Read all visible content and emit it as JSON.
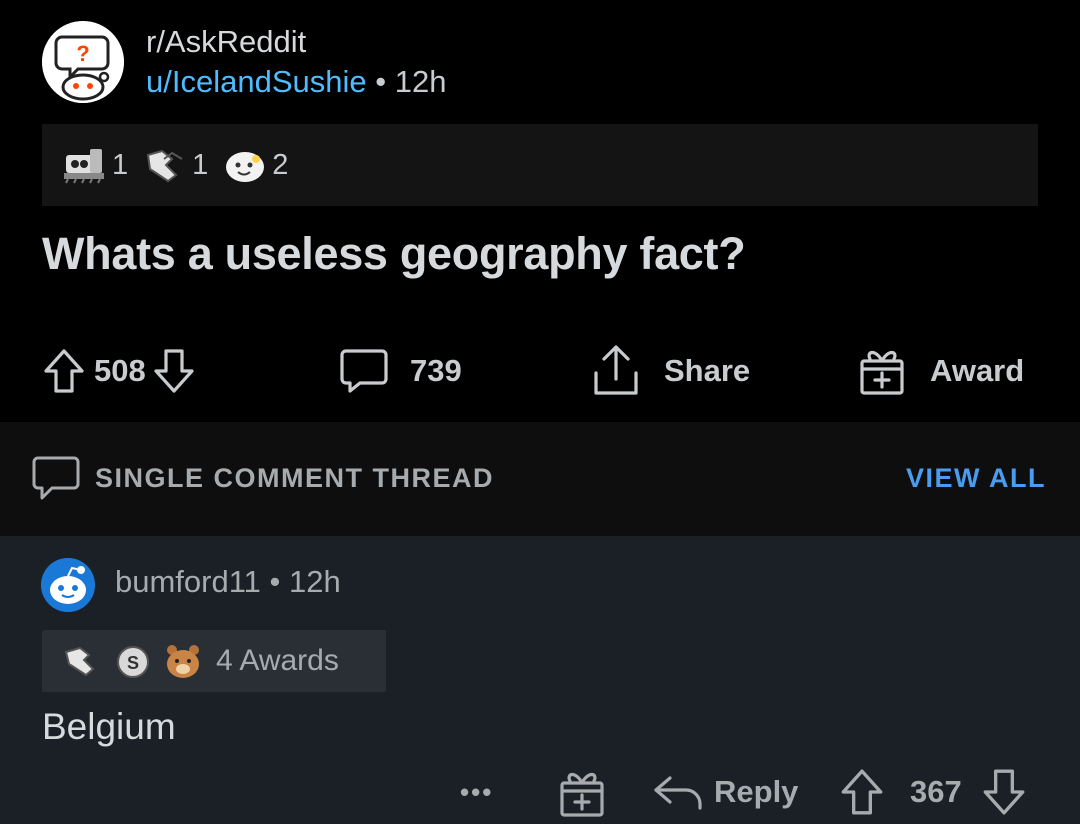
{
  "post": {
    "subreddit": "r/AskReddit",
    "author": "u/IcelandSushie",
    "separator": "•",
    "age": "12h",
    "awards": [
      {
        "icon": "train-award-icon",
        "count": "1"
      },
      {
        "icon": "handshake-award-icon",
        "count": "1"
      },
      {
        "icon": "wholesome-award-icon",
        "count": "2"
      }
    ],
    "title": "Whats a useless geography fact?",
    "upvotes": "508",
    "comments": "739",
    "share_label": "Share",
    "award_label": "Award"
  },
  "thread": {
    "label": "SINGLE COMMENT THREAD",
    "view_all": "VIEW ALL"
  },
  "comment": {
    "author": "bumford11",
    "separator": "•",
    "age": "12h",
    "awards_label": "4 Awards",
    "award_icons": [
      "handshake-award-icon",
      "silver-award-icon",
      "bear-award-icon"
    ],
    "body": "Belgium",
    "more": "•••",
    "reply_label": "Reply",
    "votes": "367"
  },
  "colors": {
    "background": "#000000",
    "comment_bg": "#1b1f26",
    "link_blue": "#4fbcff",
    "view_all_blue": "#4a9cf0",
    "text": "#d7dadc"
  }
}
